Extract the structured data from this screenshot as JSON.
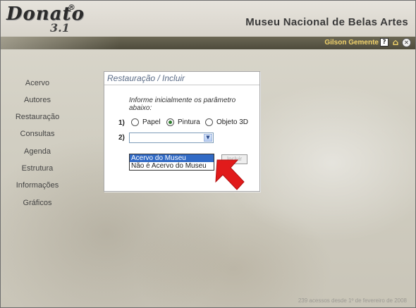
{
  "header": {
    "logo_text": "Donato",
    "logo_version": "3.1",
    "logo_reg": "®",
    "site_title": "Museu Nacional de Belas Artes"
  },
  "topbar": {
    "user_name": "Gilson Gemente",
    "help_icon": "?",
    "home_icon": "⌂",
    "close_icon": "✕"
  },
  "sidebar": {
    "items": [
      {
        "label": "Acervo"
      },
      {
        "label": "Autores"
      },
      {
        "label": "Restauração"
      },
      {
        "label": "Consultas"
      },
      {
        "label": "Agenda"
      },
      {
        "label": "Estrutura"
      },
      {
        "label": "Informações"
      },
      {
        "label": "Gráficos"
      }
    ]
  },
  "panel": {
    "title": "Restauração / Incluir",
    "instruction": "Informe inicialmente os parâmetro abaixo:",
    "step1": "1)",
    "step2": "2)",
    "radios": [
      {
        "label": "Papel",
        "checked": false
      },
      {
        "label": "Pintura",
        "checked": true
      },
      {
        "label": "Objeto 3D",
        "checked": false
      }
    ],
    "select_value": "",
    "select_arrow": "▼",
    "options": [
      "Acervo do Museu",
      "Não é Acervo do Museu"
    ],
    "submit_label": "Incluir"
  },
  "footer": {
    "text": "239 acessos desde 1º de fevereiro de 2008"
  },
  "colors": {
    "arrow": "#e11b1b",
    "topbar": "#4e4b3c",
    "user_name": "#f2d36b",
    "panel_title": "#5a6b86"
  }
}
